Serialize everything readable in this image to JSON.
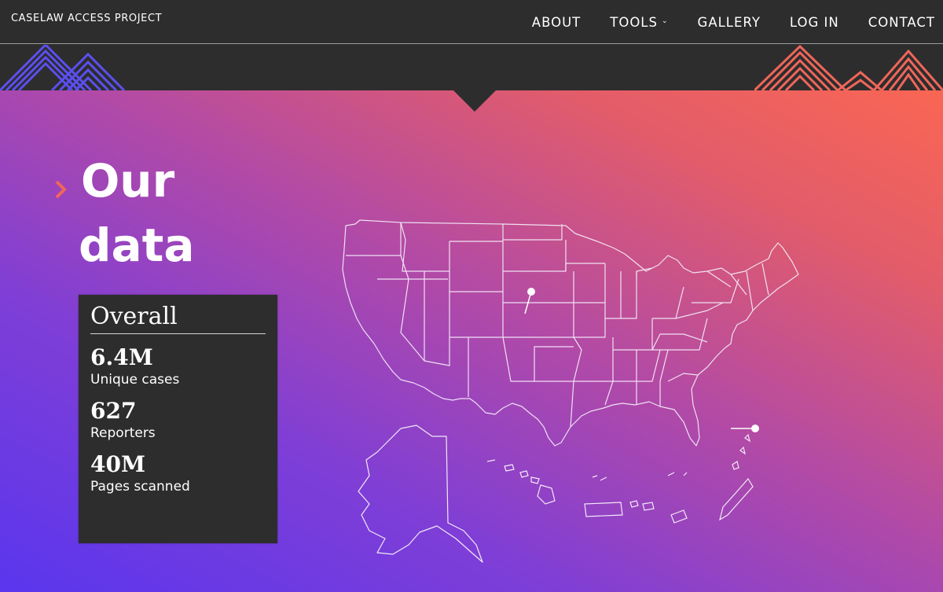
{
  "nav": {
    "brand": "CASELAW ACCESS PROJECT",
    "items": [
      {
        "label": "ABOUT"
      },
      {
        "label": "TOOLS",
        "has_dropdown": true
      },
      {
        "label": "GALLERY"
      },
      {
        "label": "LOG IN"
      },
      {
        "label": "CONTACT"
      }
    ]
  },
  "hero": {
    "title_line1": "Our",
    "title_line2": "data",
    "gradient": {
      "from": "#5a36ee",
      "to": "#fa6653"
    },
    "accent_color": "#f0665a"
  },
  "stats": {
    "heading": "Overall",
    "items": [
      {
        "value": "6.4M",
        "label": "Unique cases"
      },
      {
        "value": "627",
        "label": "Reporters"
      },
      {
        "value": "40M",
        "label": "Pages scanned"
      }
    ]
  },
  "map": {
    "icon": "us-states-map",
    "markers": [
      "north-dakota-marker",
      "mid-atlantic-marker"
    ]
  },
  "colors": {
    "nav_bg": "#2d2d2d",
    "mountain_left": "#5b4ff0",
    "mountain_right": "#f0665a"
  }
}
